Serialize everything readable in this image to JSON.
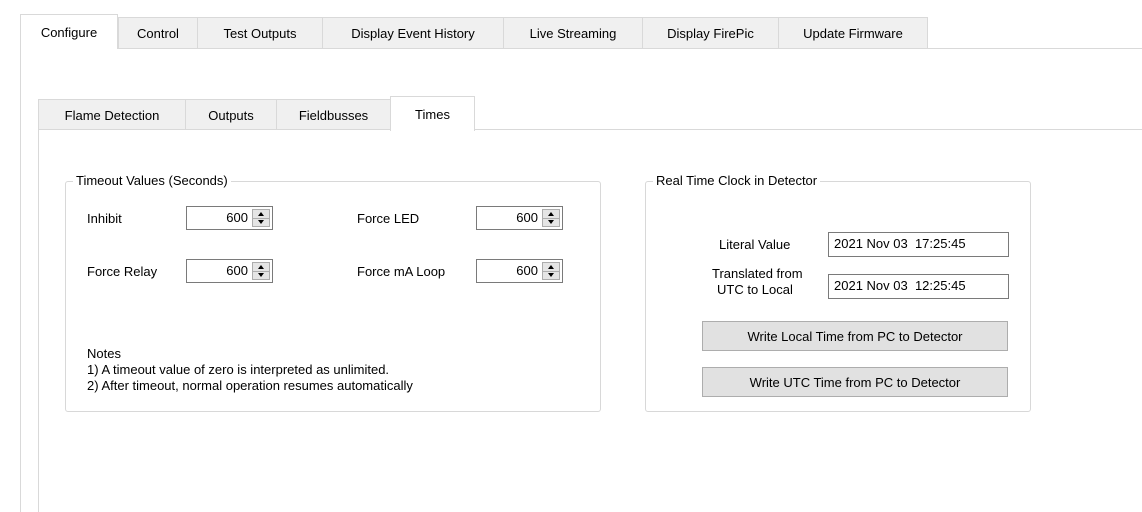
{
  "top_tabs": [
    {
      "label": "Configure",
      "active": true
    },
    {
      "label": "Control",
      "active": false
    },
    {
      "label": "Test Outputs",
      "active": false
    },
    {
      "label": "Display Event History",
      "active": false
    },
    {
      "label": "Live Streaming",
      "active": false
    },
    {
      "label": "Display FirePic",
      "active": false
    },
    {
      "label": "Update Firmware",
      "active": false
    }
  ],
  "sub_tabs": [
    {
      "label": "Flame Detection",
      "active": false
    },
    {
      "label": "Outputs",
      "active": false
    },
    {
      "label": "Fieldbusses",
      "active": false
    },
    {
      "label": "Times",
      "active": true
    }
  ],
  "timeout_group": {
    "title": "Timeout Values (Seconds)",
    "inhibit_label": "Inhibit",
    "inhibit_value": "600",
    "force_led_label": "Force LED",
    "force_led_value": "600",
    "force_relay_label": "Force Relay",
    "force_relay_value": "600",
    "force_ma_label": "Force mA Loop",
    "force_ma_value": "600",
    "notes_title": "Notes",
    "note1": "1) A timeout value of zero is interpreted as unlimited.",
    "note2": "2) After timeout, normal operation resumes automatically"
  },
  "clock_group": {
    "title": "Real Time Clock in Detector",
    "literal_label": "Literal Value",
    "literal_value": "2021 Nov 03  17:25:45",
    "translated_label_line1": "Translated from",
    "translated_label_line2": "UTC to Local",
    "translated_value": "2021 Nov 03  12:25:45",
    "write_local_button": "Write Local Time from PC to Detector",
    "write_utc_button": "Write UTC Time from PC to Detector"
  }
}
